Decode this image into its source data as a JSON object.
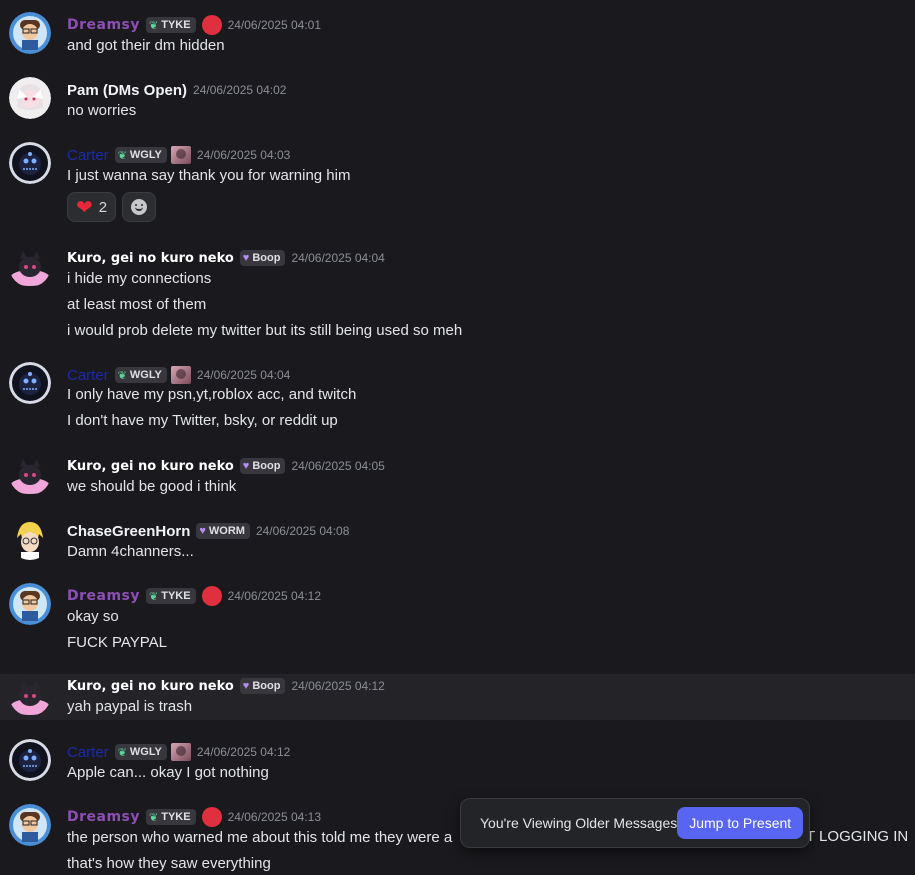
{
  "messages": [
    {
      "author": "Dreamsy",
      "tag": "TYKE",
      "time": "24/06/2025 04:01",
      "lines": [
        "and got their dm hidden"
      ]
    },
    {
      "author": "Pam (DMs Open)",
      "time": "24/06/2025 04:02",
      "lines": [
        "no worries"
      ]
    },
    {
      "author": "Carter",
      "tag": "WGLY",
      "time": "24/06/2025 04:03",
      "lines": [
        "I just wanna say thank you for warning him"
      ],
      "reactions": [
        {
          "emoji": "heart",
          "count": "2"
        },
        {
          "emoji": "add-reaction"
        }
      ]
    },
    {
      "author": "Kuro, gei no kuro neko",
      "tag": "Boop",
      "time": "24/06/2025 04:04",
      "lines": [
        "i hide my connections",
        "at least most of them",
        "i would prob delete my twitter but its still being used so meh"
      ]
    },
    {
      "author": "Carter",
      "tag": "WGLY",
      "time": "24/06/2025 04:04",
      "lines": [
        "I only have my psn,yt,roblox acc, and twitch",
        "I don't have my Twitter, bsky, or reddit up"
      ]
    },
    {
      "author": "Kuro, gei no kuro neko",
      "tag": "Boop",
      "time": "24/06/2025 04:05",
      "lines": [
        "we should be good i think"
      ]
    },
    {
      "author": "ChaseGreenHorn",
      "tag": "WORM",
      "time": "24/06/2025 04:08",
      "lines": [
        "Damn 4channers..."
      ]
    },
    {
      "author": "Dreamsy",
      "tag": "TYKE",
      "time": "24/06/2025 04:12",
      "lines": [
        "okay so",
        "FUCK PAYPAL"
      ]
    },
    {
      "author": "Kuro, gei no kuro neko",
      "tag": "Boop",
      "time": "24/06/2025 04:12",
      "lines": [
        "yah paypal is trash"
      ]
    },
    {
      "author": "Carter",
      "tag": "WGLY",
      "time": "24/06/2025 04:12",
      "lines": [
        "Apple can... okay I got nothing"
      ]
    },
    {
      "author": "Dreamsy",
      "tag": "TYKE",
      "time": "24/06/2025 04:13",
      "lines": [
        "the person who warned me about this told me they were a",
        "that's how they saw everything"
      ],
      "hidden_tail": "T LOGGING IN"
    }
  ],
  "older_bar": {
    "text": "You're Viewing Older Messages",
    "button": "Jump to Present"
  },
  "colors": {
    "background": "#1a1a1e",
    "accent": "#5865f2",
    "dreamsy": "#8c4fb5",
    "carter": "#1d2aa8"
  }
}
